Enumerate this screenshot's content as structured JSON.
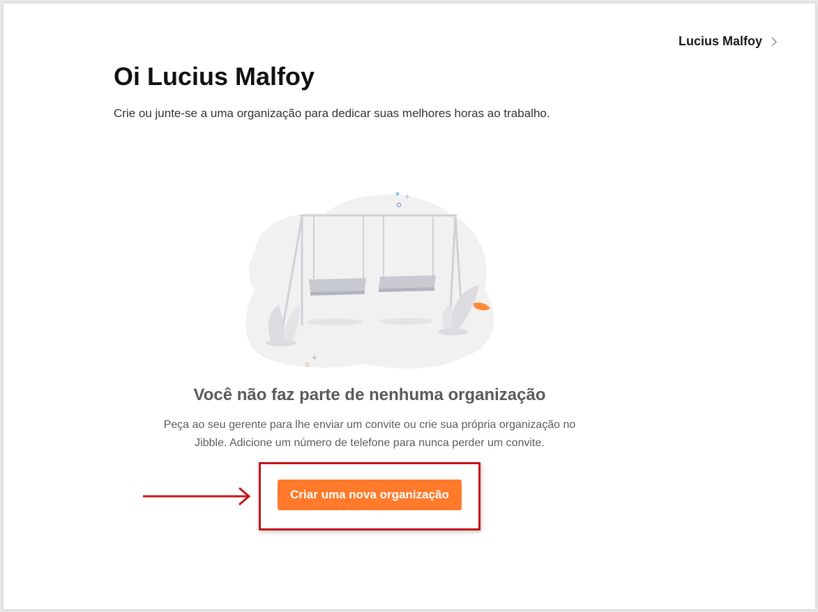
{
  "header": {
    "user_name": "Lucius Malfoy",
    "user_menu_icon": "chevron-right-icon"
  },
  "main": {
    "greeting": "Oi Lucius Malfoy",
    "subtitle": "Crie ou junte-se a uma organização para dedicar suas melhores horas ao trabalho.",
    "illustration_icon": "empty-swing-illustration",
    "empty_title": "Você não faz parte de nenhuma organização",
    "empty_description": "Peça ao seu gerente para lhe enviar um convite ou crie sua própria organização no Jibble. Adicione um número de telefone para nunca perder um convite.",
    "create_button_label": "Criar uma nova organização"
  },
  "annotation": {
    "arrow_icon": "arrow-right-icon",
    "highlight_color": "#c4141b"
  },
  "colors": {
    "accent": "#ff7a2a",
    "text_primary": "#111111",
    "text_muted": "#5a5a5a"
  }
}
